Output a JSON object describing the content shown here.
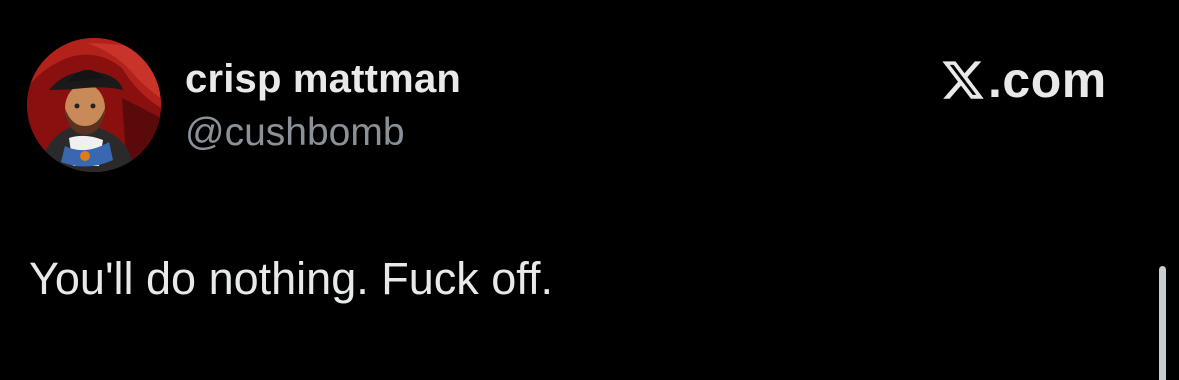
{
  "author": {
    "display_name": "crisp mattman",
    "handle": "@cushbomb",
    "avatar_icon": "portrait-avatar-icon"
  },
  "brand": {
    "domain": ".com",
    "logo_icon": "x-logo-icon"
  },
  "tweet": {
    "text": "You'll do nothing. Fuck off."
  },
  "colors": {
    "background": "#000000",
    "primary_text": "#e7e9ea",
    "secondary_text": "#8b9199",
    "avatar_background": "#8a1010"
  }
}
